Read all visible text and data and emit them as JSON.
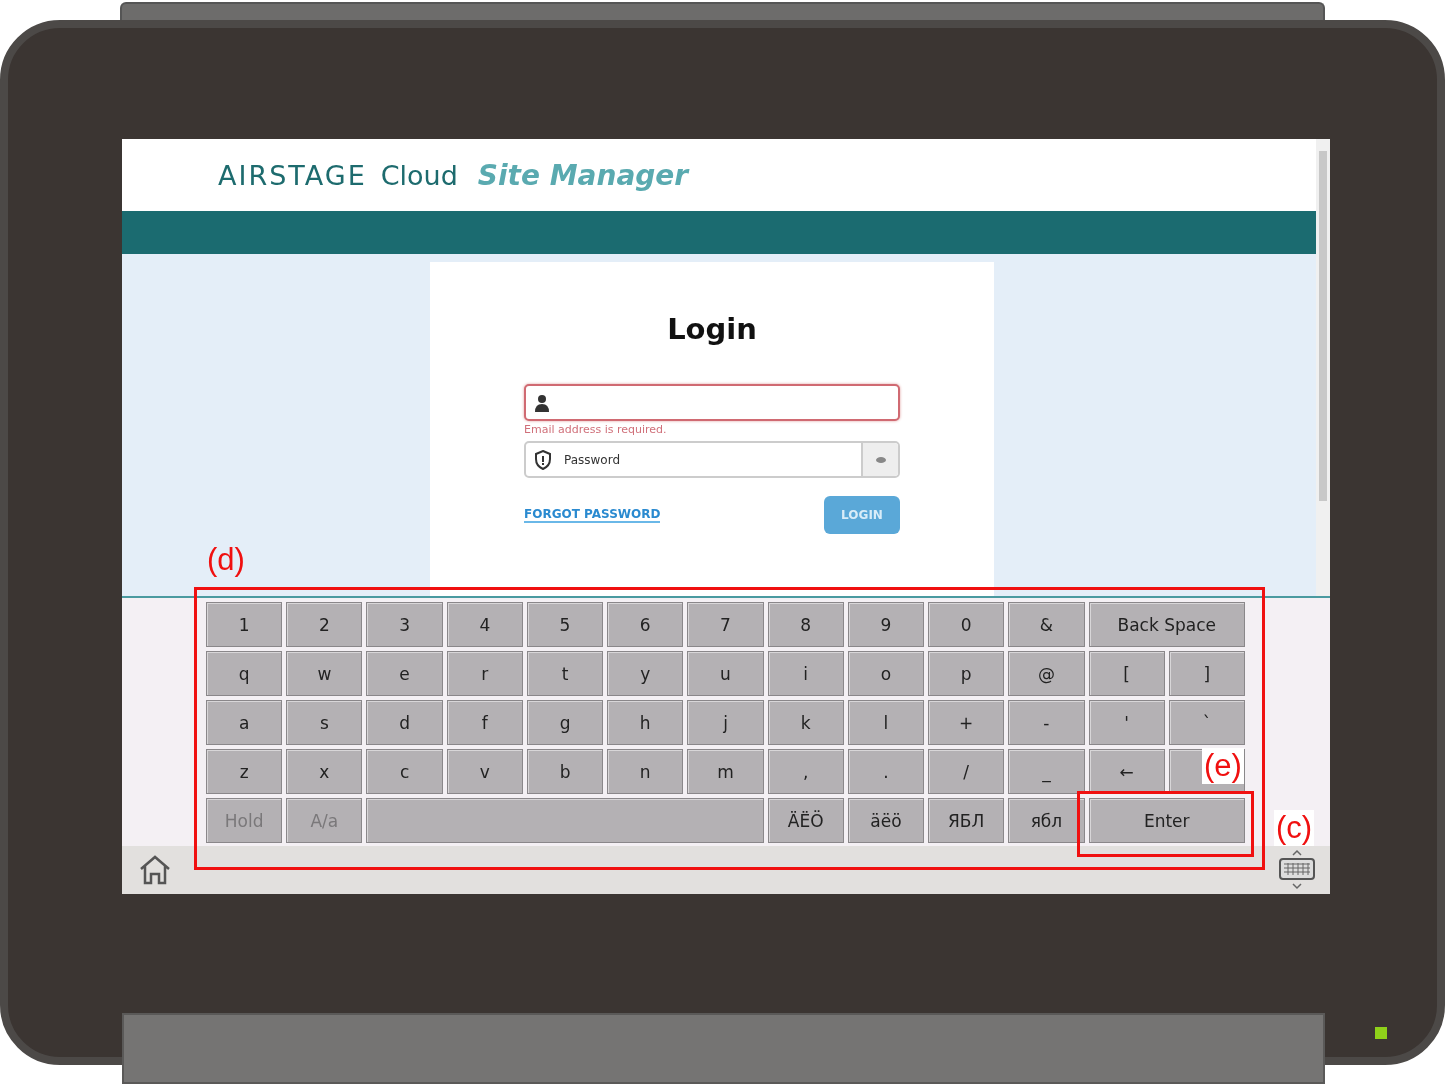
{
  "header": {
    "brand": "AIRSTAGE",
    "product": "Cloud",
    "app": "Site Manager"
  },
  "login": {
    "title": "Login",
    "email": {
      "invalid": true,
      "error": "Email address is required."
    },
    "password": {
      "placeholder": "Password"
    },
    "forgot_link": "FORGOT PASSWORD",
    "login_button": "LOGIN"
  },
  "keyboard": {
    "rows": [
      [
        {
          "label": "1",
          "kind": "key"
        },
        {
          "label": "2",
          "kind": "key"
        },
        {
          "label": "3",
          "kind": "key"
        },
        {
          "label": "4",
          "kind": "key"
        },
        {
          "label": "5",
          "kind": "key"
        },
        {
          "label": "6",
          "kind": "key"
        },
        {
          "label": "7",
          "kind": "key"
        },
        {
          "label": "8",
          "kind": "key"
        },
        {
          "label": "9",
          "kind": "key"
        },
        {
          "label": "0",
          "kind": "key"
        },
        {
          "label": "&",
          "kind": "key"
        },
        {
          "label": "Back Space",
          "kind": "wide"
        }
      ],
      [
        {
          "label": "q",
          "kind": "key"
        },
        {
          "label": "w",
          "kind": "key"
        },
        {
          "label": "e",
          "kind": "key"
        },
        {
          "label": "r",
          "kind": "key"
        },
        {
          "label": "t",
          "kind": "key"
        },
        {
          "label": "y",
          "kind": "key"
        },
        {
          "label": "u",
          "kind": "key"
        },
        {
          "label": "i",
          "kind": "key"
        },
        {
          "label": "o",
          "kind": "key"
        },
        {
          "label": "p",
          "kind": "key"
        },
        {
          "label": "@",
          "kind": "key"
        },
        {
          "label": "[",
          "kind": "key"
        },
        {
          "label": "]",
          "kind": "key"
        }
      ],
      [
        {
          "label": "a",
          "kind": "key"
        },
        {
          "label": "s",
          "kind": "key"
        },
        {
          "label": "d",
          "kind": "key"
        },
        {
          "label": "f",
          "kind": "key"
        },
        {
          "label": "g",
          "kind": "key"
        },
        {
          "label": "h",
          "kind": "key"
        },
        {
          "label": "j",
          "kind": "key"
        },
        {
          "label": "k",
          "kind": "key"
        },
        {
          "label": "l",
          "kind": "key"
        },
        {
          "label": "+",
          "kind": "key"
        },
        {
          "label": "-",
          "kind": "key"
        },
        {
          "label": "'",
          "kind": "key"
        },
        {
          "label": "`",
          "kind": "key"
        }
      ],
      [
        {
          "label": "z",
          "kind": "key"
        },
        {
          "label": "x",
          "kind": "key"
        },
        {
          "label": "c",
          "kind": "key"
        },
        {
          "label": "v",
          "kind": "key"
        },
        {
          "label": "b",
          "kind": "key"
        },
        {
          "label": "n",
          "kind": "key"
        },
        {
          "label": "m",
          "kind": "key"
        },
        {
          "label": ",",
          "kind": "key"
        },
        {
          "label": ".",
          "kind": "key"
        },
        {
          "label": "/",
          "kind": "key"
        },
        {
          "label": "_",
          "kind": "key"
        },
        {
          "label": "←",
          "kind": "key"
        },
        {
          "kind": "covered"
        }
      ],
      [
        {
          "label": "Hold",
          "kind": "dim"
        },
        {
          "label": "A/a",
          "kind": "dim"
        },
        {
          "kind": "space"
        },
        {
          "kind": "span"
        },
        {
          "kind": "span"
        },
        {
          "kind": "span"
        },
        {
          "kind": "span"
        },
        {
          "label": "ÄËÖ",
          "kind": "key"
        },
        {
          "label": "äëö",
          "kind": "key"
        },
        {
          "label": "ЯБЛ",
          "kind": "key"
        },
        {
          "label": "ябл",
          "kind": "key"
        },
        {
          "label": "Enter",
          "kind": "wide"
        }
      ]
    ]
  },
  "callouts": [
    {
      "label": "(d)",
      "kind": "keyboard"
    },
    {
      "label": "(e)",
      "kind": "enter"
    },
    {
      "label": "(c)",
      "kind": "toggle"
    }
  ]
}
